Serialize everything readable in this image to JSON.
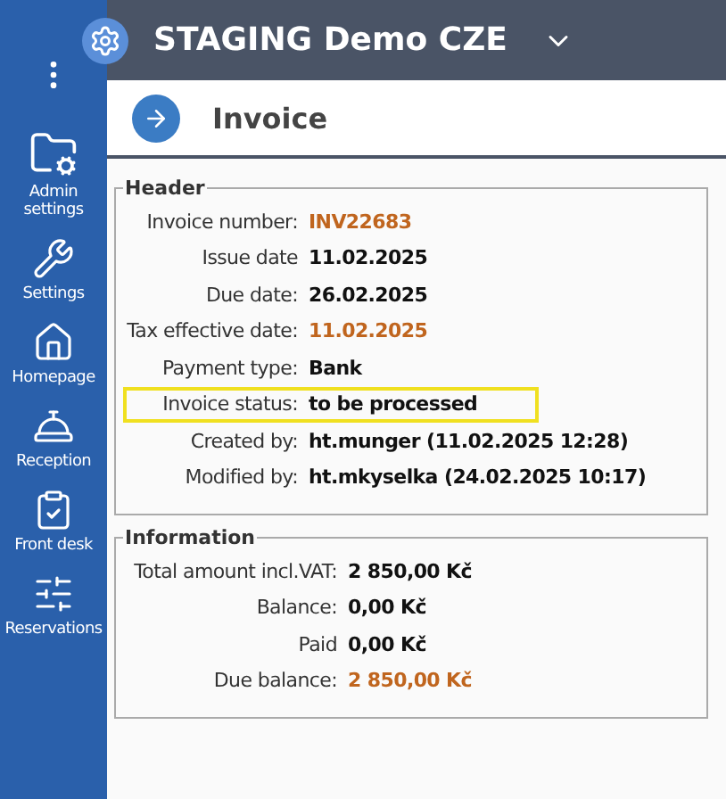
{
  "topbar": {
    "title": "STAGING Demo CZE"
  },
  "page": {
    "title": "Invoice"
  },
  "sidebar": {
    "items": [
      {
        "label": "Admin settings"
      },
      {
        "label": "Settings"
      },
      {
        "label": "Homepage"
      },
      {
        "label": "Reception"
      },
      {
        "label": "Front desk"
      },
      {
        "label": "Reservations"
      }
    ]
  },
  "sections": [
    {
      "title": "Header",
      "rows": [
        {
          "label": "Invoice number:",
          "value": "INV22683",
          "accent": true,
          "highlighted": false
        },
        {
          "label": "Issue date",
          "value": "11.02.2025",
          "accent": false,
          "highlighted": false
        },
        {
          "label": "Due date:",
          "value": "26.02.2025",
          "accent": false,
          "highlighted": false
        },
        {
          "label": "Tax effective date:",
          "value": "11.02.2025",
          "accent": true,
          "highlighted": false
        },
        {
          "label": "Payment type:",
          "value": "Bank",
          "accent": false,
          "highlighted": false
        },
        {
          "label": "Invoice status:",
          "value": "to be processed",
          "accent": false,
          "highlighted": true
        },
        {
          "label": "Created by:",
          "value": "ht.munger (11.02.2025 12:28)",
          "accent": false,
          "highlighted": false
        },
        {
          "label": "Modified by:",
          "value": "ht.mkyselka (24.02.2025 10:17)",
          "accent": false,
          "highlighted": false
        }
      ]
    },
    {
      "title": "Information",
      "rows": [
        {
          "label": "Total amount incl.VAT:",
          "value": "2 850,00 Kč",
          "accent": false,
          "highlighted": false
        },
        {
          "label": "Balance:",
          "value": "0,00 Kč",
          "accent": false,
          "highlighted": false
        },
        {
          "label": "Paid",
          "value": "0,00 Kč",
          "accent": false,
          "highlighted": false
        },
        {
          "label": "Due balance:",
          "value": "2 850,00 Kč",
          "accent": true,
          "highlighted": false
        }
      ]
    }
  ]
}
